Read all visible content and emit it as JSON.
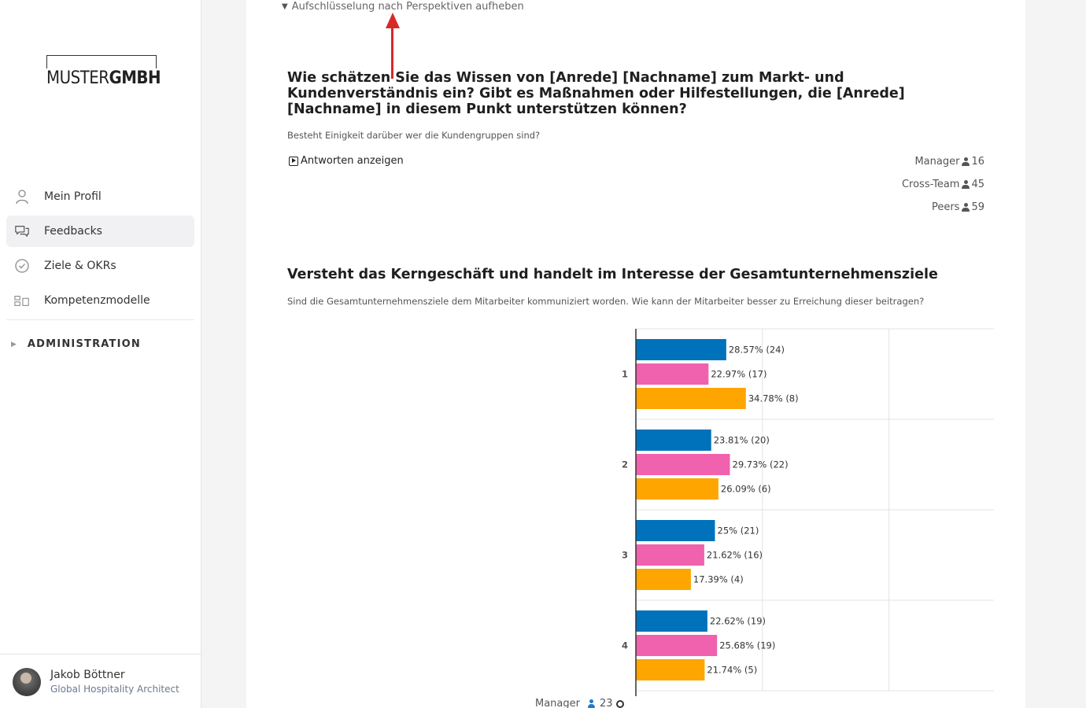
{
  "sidebar": {
    "logo": {
      "part1": "MUSTER",
      "part2": "GMBH"
    },
    "nav": [
      {
        "label": "Mein Profil",
        "icon": "user-icon",
        "active": false
      },
      {
        "label": "Feedbacks",
        "icon": "chat-icon",
        "active": true
      },
      {
        "label": "Ziele & OKRs",
        "icon": "check-circle-icon",
        "active": false
      },
      {
        "label": "Kompetenzmodelle",
        "icon": "modules-icon",
        "active": false
      }
    ],
    "admin_label": "ADMINISTRATION",
    "user": {
      "name": "Jakob Böttner",
      "role": "Global Hospitality Architect"
    }
  },
  "main": {
    "breakdown_toggle": "Aufschlüsselung nach Perspektiven aufheben",
    "question1": {
      "title": "Wie schätzen Sie das Wissen von [Anrede] [Nachname] zum Markt- und Kundenverständnis ein? Gibt es Maßnahmen oder Hilfestellungen, die [Anrede] [Nachname] in diesem Punkt unterstützen können?",
      "description": "Besteht Einigkeit darüber wer die Kundengruppen sind?",
      "answers_link": "Antworten anzeigen",
      "perspectives": [
        {
          "label": "Manager",
          "count": "16"
        },
        {
          "label": "Cross-Team",
          "count": "45"
        },
        {
          "label": "Peers",
          "count": "59"
        }
      ]
    },
    "question2": {
      "title": "Versteht das Kerngeschäft und handelt im Interesse der Gesamtunternehmensziele",
      "description": "Sind die Gesamtunternehmensziele dem Mitarbeiter kommuniziert worden. Wie kann der Mitarbeiter besser zu Erreichung dieser beitragen?"
    },
    "legend_peek": {
      "label": "Manager",
      "count": "23"
    }
  },
  "colors": {
    "blue": "#0072bb",
    "pink": "#f062ad",
    "orange": "#ffa500",
    "accent_red": "#d62a2a"
  },
  "chart_data": {
    "type": "bar",
    "orientation": "horizontal",
    "categories": [
      "1",
      "2",
      "3",
      "4"
    ],
    "series": [
      {
        "values": [
          28.57,
          23.81,
          25,
          22.62
        ],
        "counts": [
          24,
          20,
          21,
          19
        ],
        "labels": [
          "28.57% (24)",
          "23.81% (20)",
          "25% (21)",
          "22.62% (19)"
        ],
        "color": "#0072bb"
      },
      {
        "values": [
          22.97,
          29.73,
          21.62,
          25.68
        ],
        "counts": [
          17,
          22,
          16,
          19
        ],
        "labels": [
          "22.97% (17)",
          "29.73% (22)",
          "21.62% (16)",
          "25.68% (19)"
        ],
        "color": "#f062ad"
      },
      {
        "values": [
          34.78,
          26.09,
          17.39,
          21.74
        ],
        "counts": [
          8,
          6,
          4,
          5
        ],
        "labels": [
          "34.78% (8)",
          "26.09% (6)",
          "17.39% (4)",
          "21.74% (5)"
        ],
        "color": "#ffa500"
      }
    ],
    "xlim": [
      0,
      110
    ],
    "grid": true
  }
}
